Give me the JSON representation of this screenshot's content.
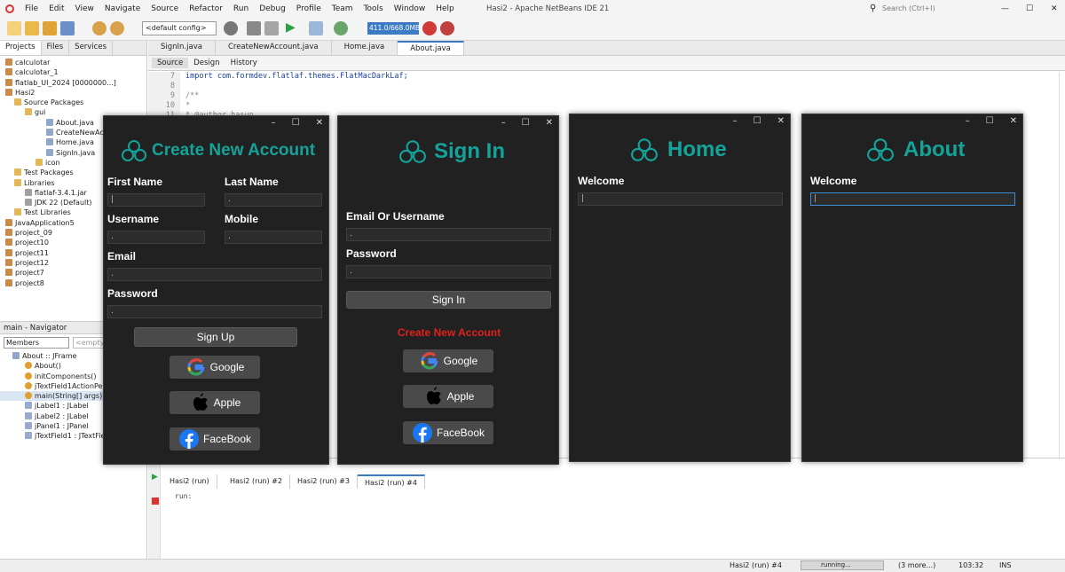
{
  "ide": {
    "title": "Hasi2 - Apache NetBeans IDE 21",
    "menu": [
      "File",
      "Edit",
      "View",
      "Navigate",
      "Source",
      "Refactor",
      "Run",
      "Debug",
      "Profile",
      "Team",
      "Tools",
      "Window",
      "Help"
    ],
    "search_placeholder": "Search (Ctrl+I)",
    "config": "<default config>",
    "memory": "411.0/668.0MB"
  },
  "left": {
    "tabs": [
      "Projects",
      "Files",
      "Services"
    ],
    "tree": [
      "calculotar",
      "calculotar_1",
      "flatlab_UI_2024 [0000000...]",
      "Hasi2",
      "Source Packages",
      "gui",
      "About.java",
      "CreateNewAcco",
      "Home.java",
      "SignIn.java",
      "icon",
      "Test Packages",
      "Libraries",
      "flatlaf-3.4.1.jar",
      "JDK 22 (Default)",
      "Test Libraries",
      "JavaApplication5",
      "project_09",
      "project10",
      "project11",
      "project12",
      "project7",
      "project8"
    ],
    "navigator_title": "main - Navigator",
    "members_label": "Members",
    "empty_label": "<empty>",
    "nav_items": [
      "About :: JFrame",
      "About()",
      "initComponents()",
      "jTextField1ActionPerfo",
      "main(String[] args)",
      "jLabel1 : JLabel",
      "jLabel2 : JLabel",
      "jPanel1 : JPanel",
      "jTextField1 : JTextField"
    ]
  },
  "editor": {
    "tabs": [
      "SignIn.java",
      "CreateNewAccount.java",
      "Home.java",
      "About.java"
    ],
    "subtabs": [
      "Source",
      "Design",
      "History"
    ],
    "lines": [
      {
        "n": "7",
        "code": "import com.formdev.flatlaf.themes.FlatMacDarkLaf;"
      },
      {
        "n": "8",
        "code": ""
      },
      {
        "n": "9",
        "code": "/**"
      },
      {
        "n": "10",
        "code": " *"
      },
      {
        "n": "11",
        "code": " * @author hasun"
      }
    ]
  },
  "output": {
    "tabs": [
      "Hasi2 (run)",
      "Hasi2 (run) #2",
      "Hasi2 (run) #3",
      "Hasi2 (run) #4"
    ],
    "text": "run:"
  },
  "status": {
    "run": "Hasi2 (run) #4",
    "progress": "running...",
    "more": "(3 more...)",
    "pos": "103:32",
    "mode": "INS"
  },
  "windows": {
    "create": {
      "title": "Create New Account",
      "first_name": "First Name",
      "last_name": "Last Name",
      "username": "Username",
      "mobile": "Mobile",
      "email": "Email",
      "password": "Password",
      "signup": "Sign Up",
      "google": "Google",
      "apple": "Apple",
      "facebook": "FaceBook"
    },
    "signin": {
      "title": "Sign In",
      "email_user": "Email Or Username",
      "password": "Password",
      "signin_btn": "Sign In",
      "create_link": "Create New Account",
      "google": "Google",
      "apple": "Apple",
      "facebook": "FaceBook"
    },
    "home": {
      "title": "Home",
      "welcome": "Welcome"
    },
    "about": {
      "title": "About",
      "welcome": "Welcome"
    }
  },
  "colors": {
    "accent": "#14a39a",
    "link_red": "#e0201c",
    "dark_bg": "#212121"
  }
}
